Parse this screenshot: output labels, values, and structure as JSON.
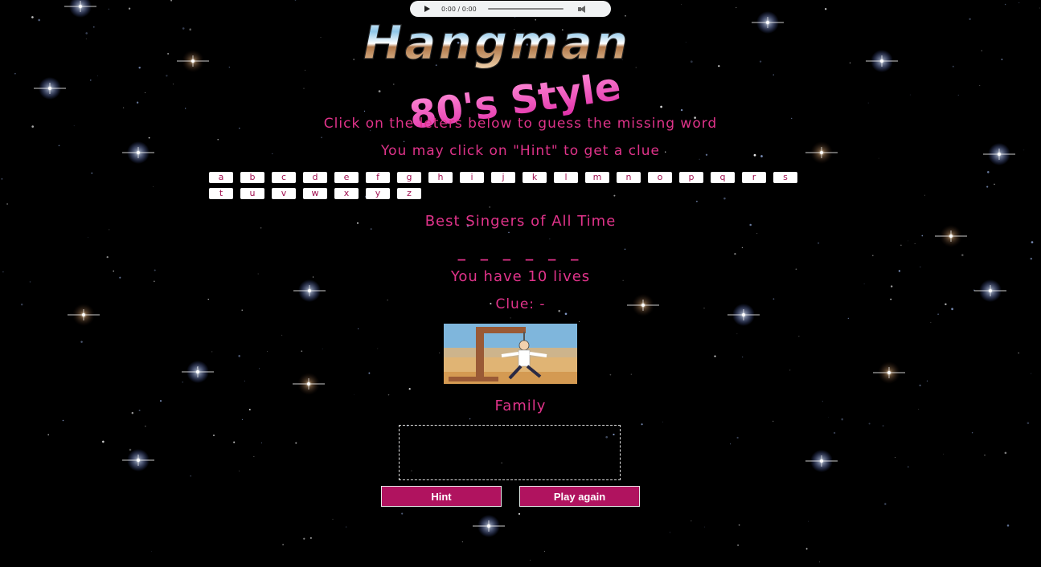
{
  "audio": {
    "time": "0:00 / 0:00"
  },
  "header": {
    "title": "Hangman",
    "subtitle": "80's Style"
  },
  "instructions": {
    "line1": "Click on the leters below to guess the missing word",
    "line2": "You may click on \"Hint\" to get a clue"
  },
  "letters": [
    "a",
    "b",
    "c",
    "d",
    "e",
    "f",
    "g",
    "h",
    "i",
    "j",
    "k",
    "l",
    "m",
    "n",
    "o",
    "p",
    "q",
    "r",
    "s",
    "t",
    "u",
    "v",
    "w",
    "x",
    "y",
    "z"
  ],
  "game": {
    "category": "Best Singers of All Time",
    "word_display": "_ _ _ _ _ _",
    "lives": "You have 10 lives",
    "clue_label": "Clue: -",
    "clue_text": "Family"
  },
  "buttons": {
    "hint": "Hint",
    "play_again": "Play again"
  },
  "colors": {
    "accent_pink": "#e0338a",
    "button": "#b0135f",
    "background": "#000000"
  }
}
